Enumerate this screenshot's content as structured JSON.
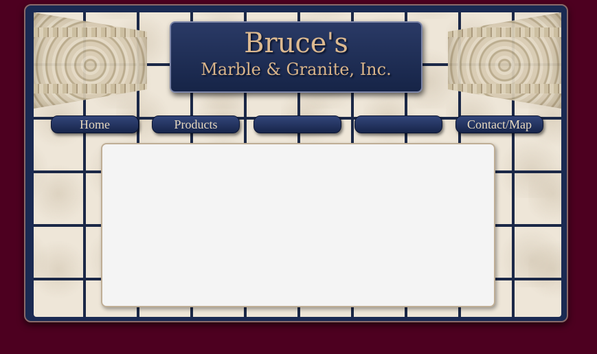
{
  "logo": {
    "title": "Bruce's",
    "subtitle": "Marble & Granite, Inc."
  },
  "nav": {
    "items": [
      {
        "label": "Home"
      },
      {
        "label": "Products"
      },
      {
        "label": ""
      },
      {
        "label": ""
      },
      {
        "label": "Contact/Map"
      }
    ]
  },
  "colors": {
    "background": "#4d0020",
    "frame": "#1a2a52",
    "accent_text": "#dcb990"
  }
}
